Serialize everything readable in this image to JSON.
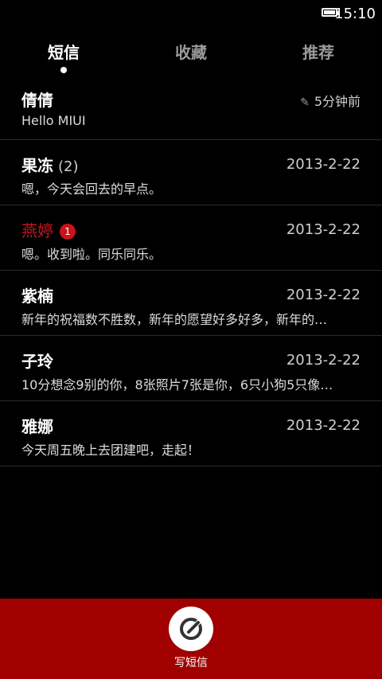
{
  "status": {
    "time": "15:10"
  },
  "tabs": [
    {
      "label": "短信",
      "active": true
    },
    {
      "label": "收藏",
      "active": false
    },
    {
      "label": "推荐",
      "active": false
    }
  ],
  "conversations": [
    {
      "name": "倩倩",
      "time": "5分钟前",
      "preview": "Hello MIUI",
      "draft": true
    },
    {
      "name": "果冻",
      "count": "(2)",
      "time": "2013-2-22",
      "preview": "嗯，今天会回去的早点。"
    },
    {
      "name": "燕婷",
      "unread": "1",
      "time": "2013-2-22",
      "preview": "嗯。收到啦。同乐同乐。"
    },
    {
      "name": "紫楠",
      "time": "2013-2-22",
      "preview": "新年的祝福数不胜数，新年的愿望好多好多，新年的…"
    },
    {
      "name": "子玲",
      "time": "2013-2-22",
      "preview": "10分想念9别的你，8张照片7张是你，6只小狗5只像…"
    },
    {
      "name": "雅娜",
      "time": "2013-2-22",
      "preview": "今天周五晚上去团建吧，走起！"
    }
  ],
  "compose": {
    "label": "写短信"
  },
  "colors": {
    "accent": "#a00000",
    "unread": "#c8141a"
  },
  "icons": {
    "battery": "battery-icon",
    "pencil": "pencil-icon",
    "compose": "compose-icon"
  }
}
